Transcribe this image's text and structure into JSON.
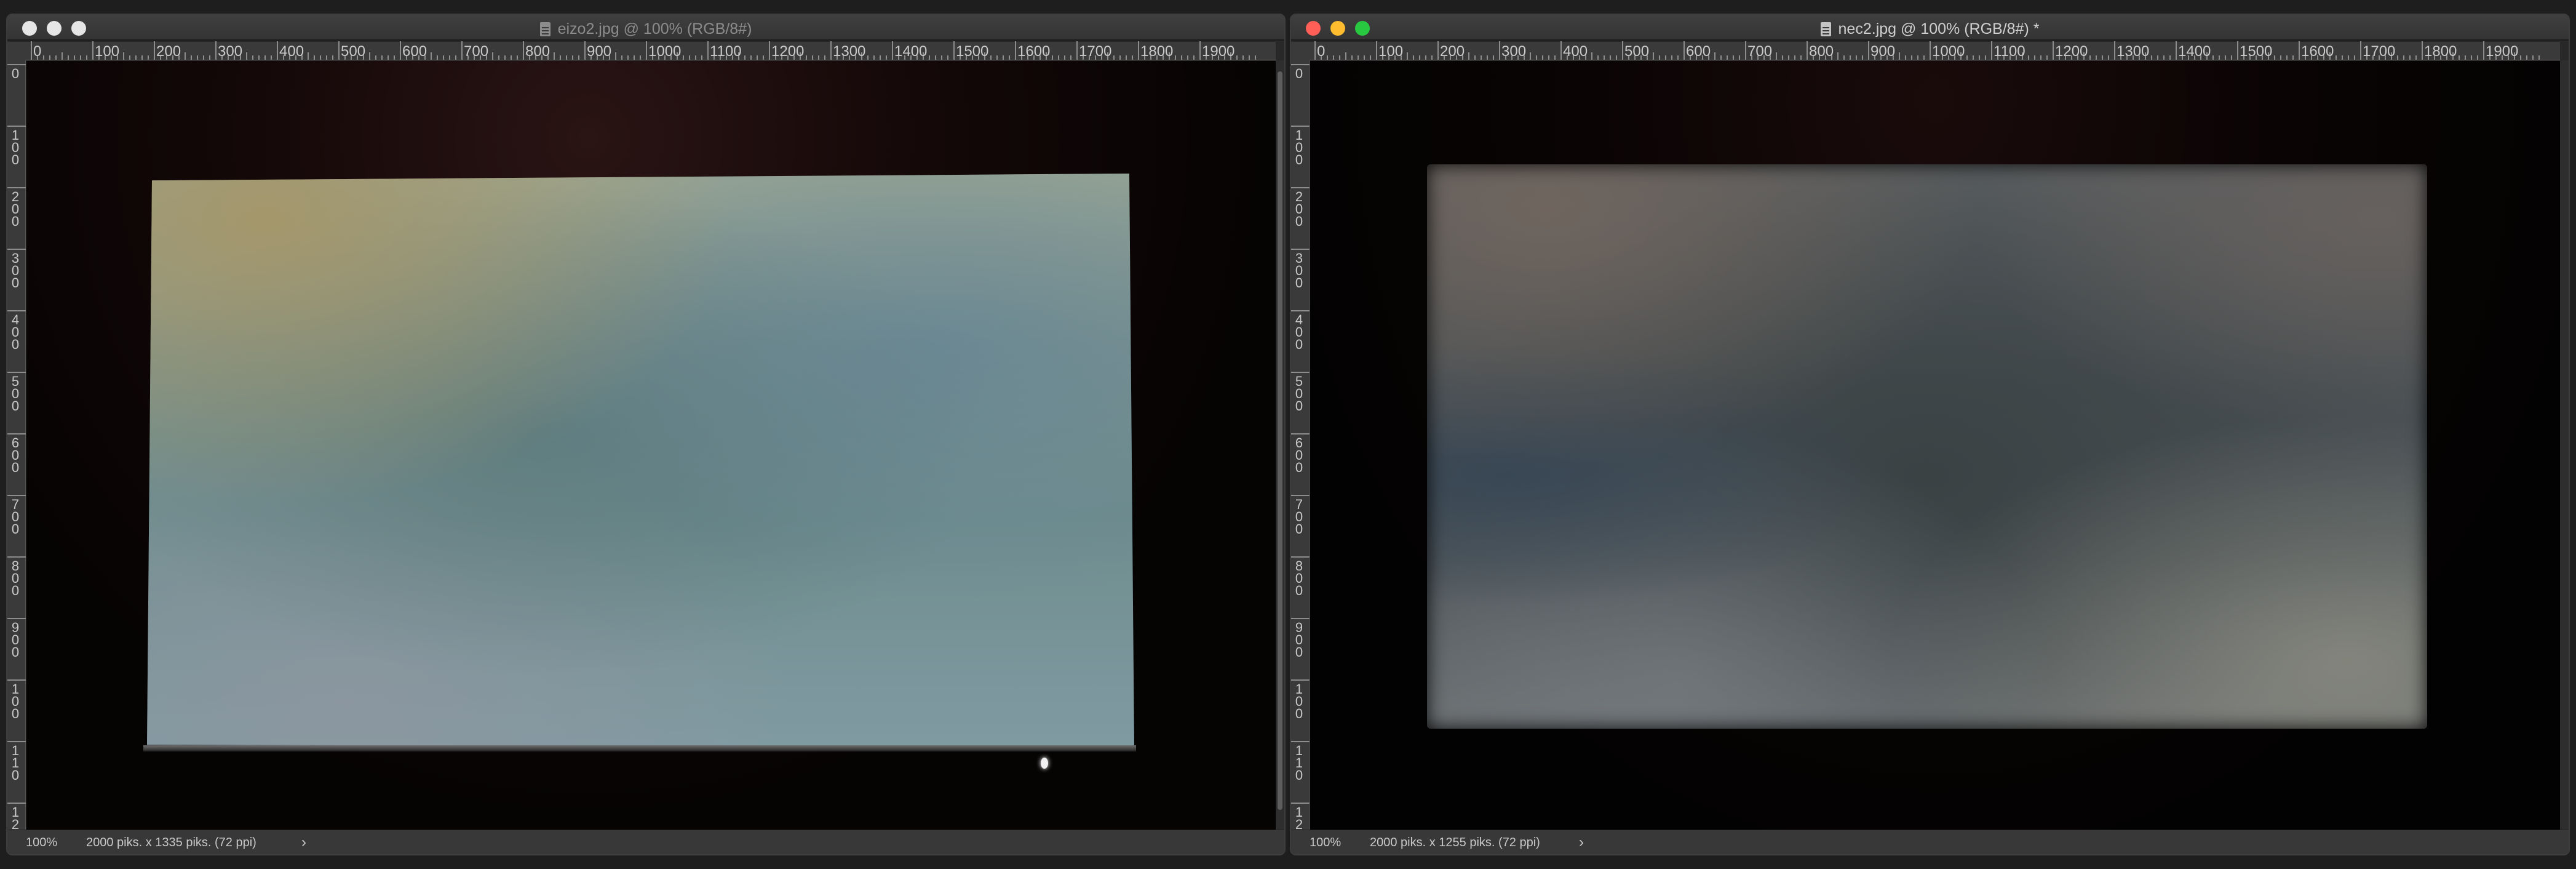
{
  "windows": [
    {
      "id": "left",
      "title": "eizo2.jpg @ 100% (RGB/8#)",
      "state": "inactive",
      "zoom": "100%",
      "dimensions": "2000 piks. x 1335 piks. (72 ppi)",
      "hruler_labels": [
        "0",
        "100",
        "200",
        "300",
        "400",
        "500",
        "600",
        "700",
        "800",
        "900",
        "1000",
        "1100",
        "1200",
        "1300",
        "1400",
        "1500",
        "1600",
        "1700",
        "1800",
        "1900"
      ],
      "vruler_labels": [
        "0",
        "1\n0\n0",
        "2\n0\n0",
        "3\n0\n0",
        "4\n0\n0",
        "5\n0\n0",
        "6\n0\n0",
        "7\n0\n0",
        "8\n0\n0",
        "9\n0\n0",
        "1\n0\n0",
        "1\n1\n0",
        "1\n2"
      ]
    },
    {
      "id": "right",
      "title": "nec2.jpg @ 100% (RGB/8#) *",
      "state": "active",
      "zoom": "100%",
      "dimensions": "2000 piks. x 1255 piks. (72 ppi)",
      "hruler_labels": [
        "0",
        "100",
        "200",
        "300",
        "400",
        "500",
        "600",
        "700",
        "800",
        "900",
        "1000",
        "1100",
        "1200",
        "1300",
        "1400",
        "1500",
        "1600",
        "1700",
        "1800",
        "1900"
      ],
      "vruler_labels": [
        "0",
        "1\n0\n0",
        "2\n0\n0",
        "3\n0\n0",
        "4\n0\n0",
        "5\n0\n0",
        "6\n0\n0",
        "7\n0\n0",
        "8\n0\n0",
        "9\n0\n0",
        "1\n0\n0",
        "1\n1\n0",
        "1\n2"
      ]
    }
  ],
  "status_chevron": "›",
  "colors": {
    "window_bg": "#282828",
    "close": "#ff5f57",
    "minimize": "#febc2e",
    "maximize": "#28c840"
  }
}
